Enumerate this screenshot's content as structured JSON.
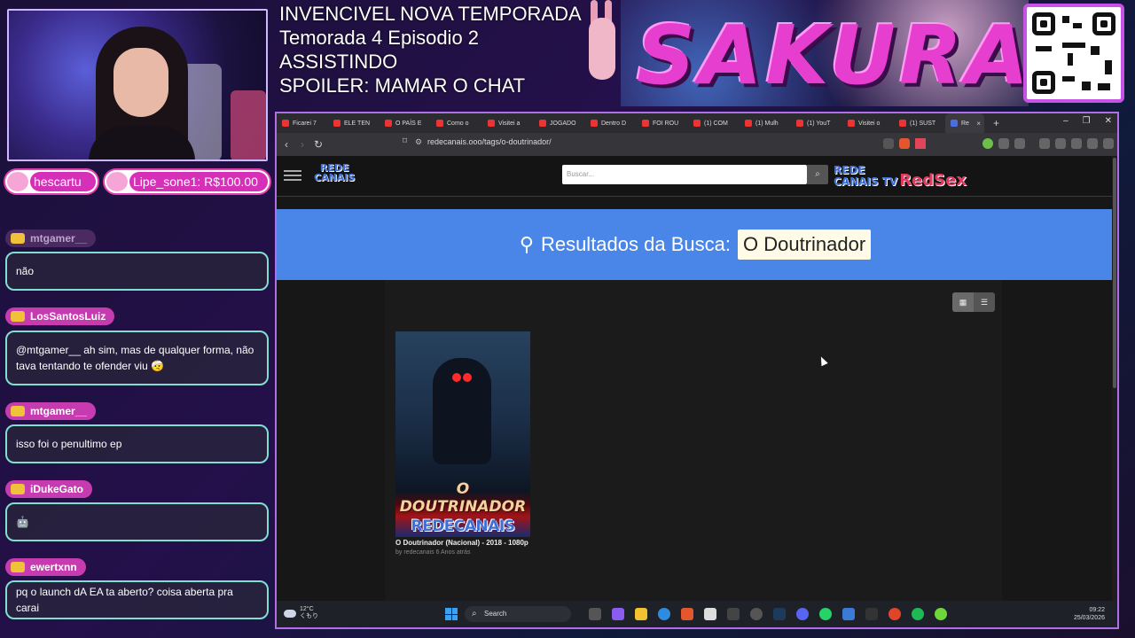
{
  "overlay": {
    "title_lines": [
      "INVENCIVEL NOVA TEMPORADA",
      "Temorada 4 Episodio 2",
      "ASSISTINDO",
      "SPOILER: MAMAR O CHAT"
    ],
    "logo_text": "SAKURA"
  },
  "top_users": [
    {
      "name": "hescartu"
    },
    {
      "name": "Lipe_sone1: R$100.00"
    }
  ],
  "chat": [
    {
      "user": "mtgamer__",
      "message": "não"
    },
    {
      "user": "LosSantosLuiz",
      "message": "@mtgamer__ ah sim, mas de qualquer forma, não tava tentando te ofender viu 🤕"
    },
    {
      "user": "mtgamer__",
      "message": "isso foi o penultimo ep"
    },
    {
      "user": "iDukeGato",
      "message": "🤖"
    },
    {
      "user": "ewertxnn",
      "message": "pq o launch dA EA ta aberto? coisa aberta pra carai"
    }
  ],
  "browser": {
    "tabs": [
      "Ficarei 7",
      "ELE TEN",
      "O PAÍS E",
      "Como o",
      "Visitei a",
      "JOGADO",
      "Dentro D",
      "FOI ROU",
      "(1) COM",
      "(1) Mulh",
      "(1) YouT",
      "Visitei o",
      "(1) SUST",
      "Re"
    ],
    "url": "redecanais.ooo/tags/o-doutrinador/",
    "site": {
      "logo_line1": "REDE",
      "logo_line2": "CANAIS",
      "search_placeholder": "Buscar...",
      "partner_line1": "REDE",
      "partner_line2": "CANAIS TV",
      "partner_red": "RedSex",
      "results_label": "Resultados da Busca:",
      "results_term": "O Doutrinador",
      "card": {
        "poster_title": "O DOUTRINADOR",
        "poster_brand": "REDECANAIS",
        "title": "O Doutrinador (Nacional) - 2018 - 1080p",
        "by_label": "by",
        "author": "redecanais",
        "age": "6 Anos atrás"
      }
    }
  },
  "taskbar": {
    "temperature": "12°C",
    "weather": "くもり",
    "search_label": "Search",
    "time": "09:22",
    "date": "25/03/2026"
  }
}
